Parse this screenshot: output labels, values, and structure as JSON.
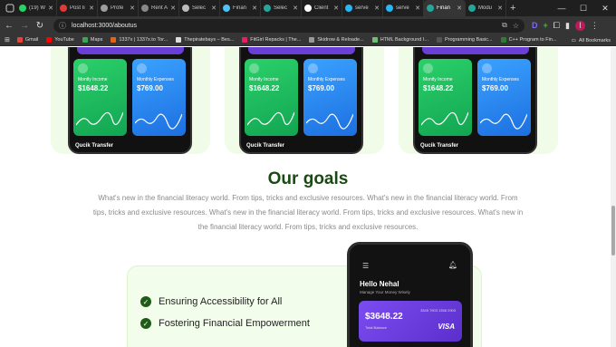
{
  "browser": {
    "tabs": [
      {
        "label": "(19) W",
        "color": "#25d366"
      },
      {
        "label": "Post Ii",
        "color": "#e53935"
      },
      {
        "label": "Profe",
        "color": "#9e9e9e"
      },
      {
        "label": "Rent A",
        "color": "#888888"
      },
      {
        "label": "Selec",
        "color": "#bbbbbb"
      },
      {
        "label": "Finan",
        "color": "#4fc3f7"
      },
      {
        "label": "Selec",
        "color": "#26a69a"
      },
      {
        "label": "Client",
        "color": "#ffffff"
      },
      {
        "label": "serve",
        "color": "#29b6f6"
      },
      {
        "label": "serve",
        "color": "#29b6f6"
      },
      {
        "label": "Finan",
        "color": "#26a69a",
        "active": true
      },
      {
        "label": "Modu",
        "color": "#26a69a"
      }
    ],
    "url": "localhost:3000/aboutus",
    "bookmarks": [
      {
        "label": "Gmail",
        "color": "#ea4335"
      },
      {
        "label": "YouTube",
        "color": "#ff0000"
      },
      {
        "label": "Maps",
        "color": "#34a853"
      },
      {
        "label": "1337x | 1337x.to Tor...",
        "color": "#e0641b"
      },
      {
        "label": "Thepiratebays – Bes...",
        "color": "#dddddd"
      },
      {
        "label": "FitGirl Repacks | The...",
        "color": "#e91e63"
      },
      {
        "label": "Skidrow & Reloade...",
        "color": "#999999"
      },
      {
        "label": "HTML Background I...",
        "color": "#6fbf73"
      },
      {
        "label": "Programming Basic...",
        "color": "#555555"
      },
      {
        "label": "C++ Program to Fin...",
        "color": "#2e7d32"
      }
    ],
    "all_bookmarks": "All Bookmarks",
    "profile_initial": "I"
  },
  "cards": {
    "income_label": "Montly Income",
    "income_value": "$1648.22",
    "expense_label": "Monthly Expenses",
    "expense_value": "$769.00",
    "quick_transfer": "Qucik Transfer"
  },
  "goals": {
    "title": "Our goals",
    "description": "What's new in the financial literacy world. From tips, tricks and exclusive resources. What's new in the financial literacy world. From tips, tricks and exclusive resources. What's new in the financial literacy world. From tips, tricks and exclusive resources. What's new in the financial literacy world. From tips, tricks and exclusive resources.",
    "items": [
      "Ensuring Accessibility for All",
      "Fostering Financial Empowerment"
    ]
  },
  "phone": {
    "greeting": "Hello Nehal",
    "subtitle": "Manage Your Money Wisely",
    "balance": "$3648.22",
    "balance_label": "Total Balance",
    "card_number": "3345 7903 1358 2903",
    "card_brand": "VISA"
  }
}
